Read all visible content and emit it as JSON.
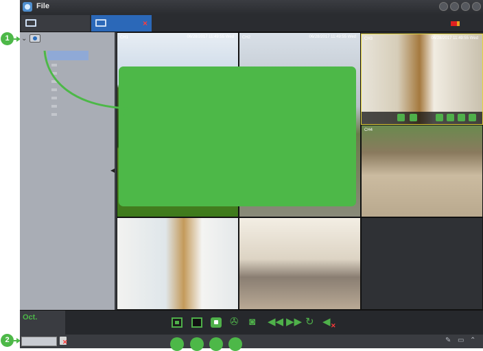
{
  "app": {
    "menu_file": "File"
  },
  "tabs": [
    {
      "name": "home"
    },
    {
      "name": "live-view",
      "close_glyph": "×"
    }
  ],
  "grid": {
    "cameras": [
      {
        "label": "CH1",
        "time": "06/28/2017 11:49:55 Wed"
      },
      {
        "label": "CH2",
        "time": "06/28/2017 11:49:55 Wed"
      },
      {
        "label": "CH3",
        "time": "06/28/2017 11:49:55 Wed"
      },
      {
        "label": "CH4",
        "time": ""
      },
      {
        "label": "",
        "time": ""
      },
      {
        "label": "",
        "time": ""
      }
    ]
  },
  "playback": {
    "date_label": "Oct."
  },
  "callouts": [
    "1",
    "2"
  ],
  "colors": {
    "accent": "#4db848",
    "selected_tab": "#2b68b8",
    "selected_cell": "#e5d43a"
  }
}
